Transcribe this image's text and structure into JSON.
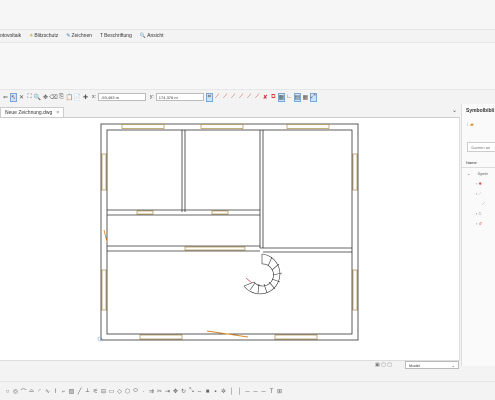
{
  "menu": {
    "items": [
      {
        "icon": "",
        "label": "otovoltaik"
      },
      {
        "icon": "✳",
        "label": "Blitzschutz"
      },
      {
        "icon": "✎",
        "label": "Zeichnen"
      },
      {
        "icon": "T",
        "label": "Beschriftung"
      },
      {
        "icon": "🔍",
        "label": "Ansicht"
      }
    ]
  },
  "toolbar": {
    "x_label": "x:",
    "x_value": "-93,493 m",
    "y_label": "y:",
    "y_value": "174,376 m"
  },
  "document": {
    "tab_label": "Neue Zeichnung.dwg",
    "tab_close": "×"
  },
  "symbol_panel": {
    "title": "Symbolbibli",
    "search_placeholder": "Suchen an",
    "column_name": "Name",
    "tree_root": "Symb",
    "collapse": "⌄"
  },
  "statusbar": {
    "model_label": "Model",
    "model_arrow": "⌄"
  },
  "colors": {
    "accent": "#2f6fb5",
    "window_blue": "#e9d6a4",
    "stair_red": "#d14a4a"
  }
}
